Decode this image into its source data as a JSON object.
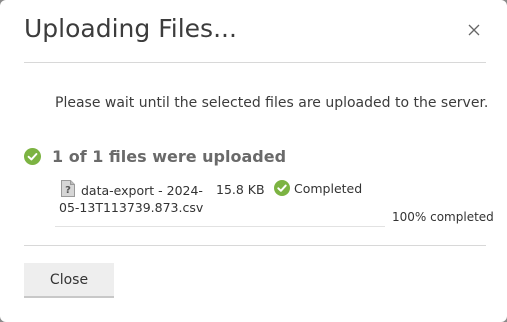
{
  "dialog": {
    "title": "Uploading Files...",
    "message": "Please wait until the selected files are uploaded to the server.",
    "summary": "1 of 1 files were uploaded",
    "files": [
      {
        "name": "data-export - 2024-05-13T113739.873.csv",
        "size": "15.8 KB",
        "status": "Completed",
        "icon": "unknown-file-icon"
      }
    ],
    "progress_label": "100% completed",
    "progress_fraction": 1.0,
    "close_label": "Close"
  },
  "colors": {
    "success": "#7cb342",
    "title": "#3c3c3c",
    "summary": "#6a6a6a",
    "button_bg": "#eeeeee"
  },
  "icons": {
    "close": "close-icon",
    "summary": "check-circle-icon",
    "status": "check-circle-icon"
  }
}
